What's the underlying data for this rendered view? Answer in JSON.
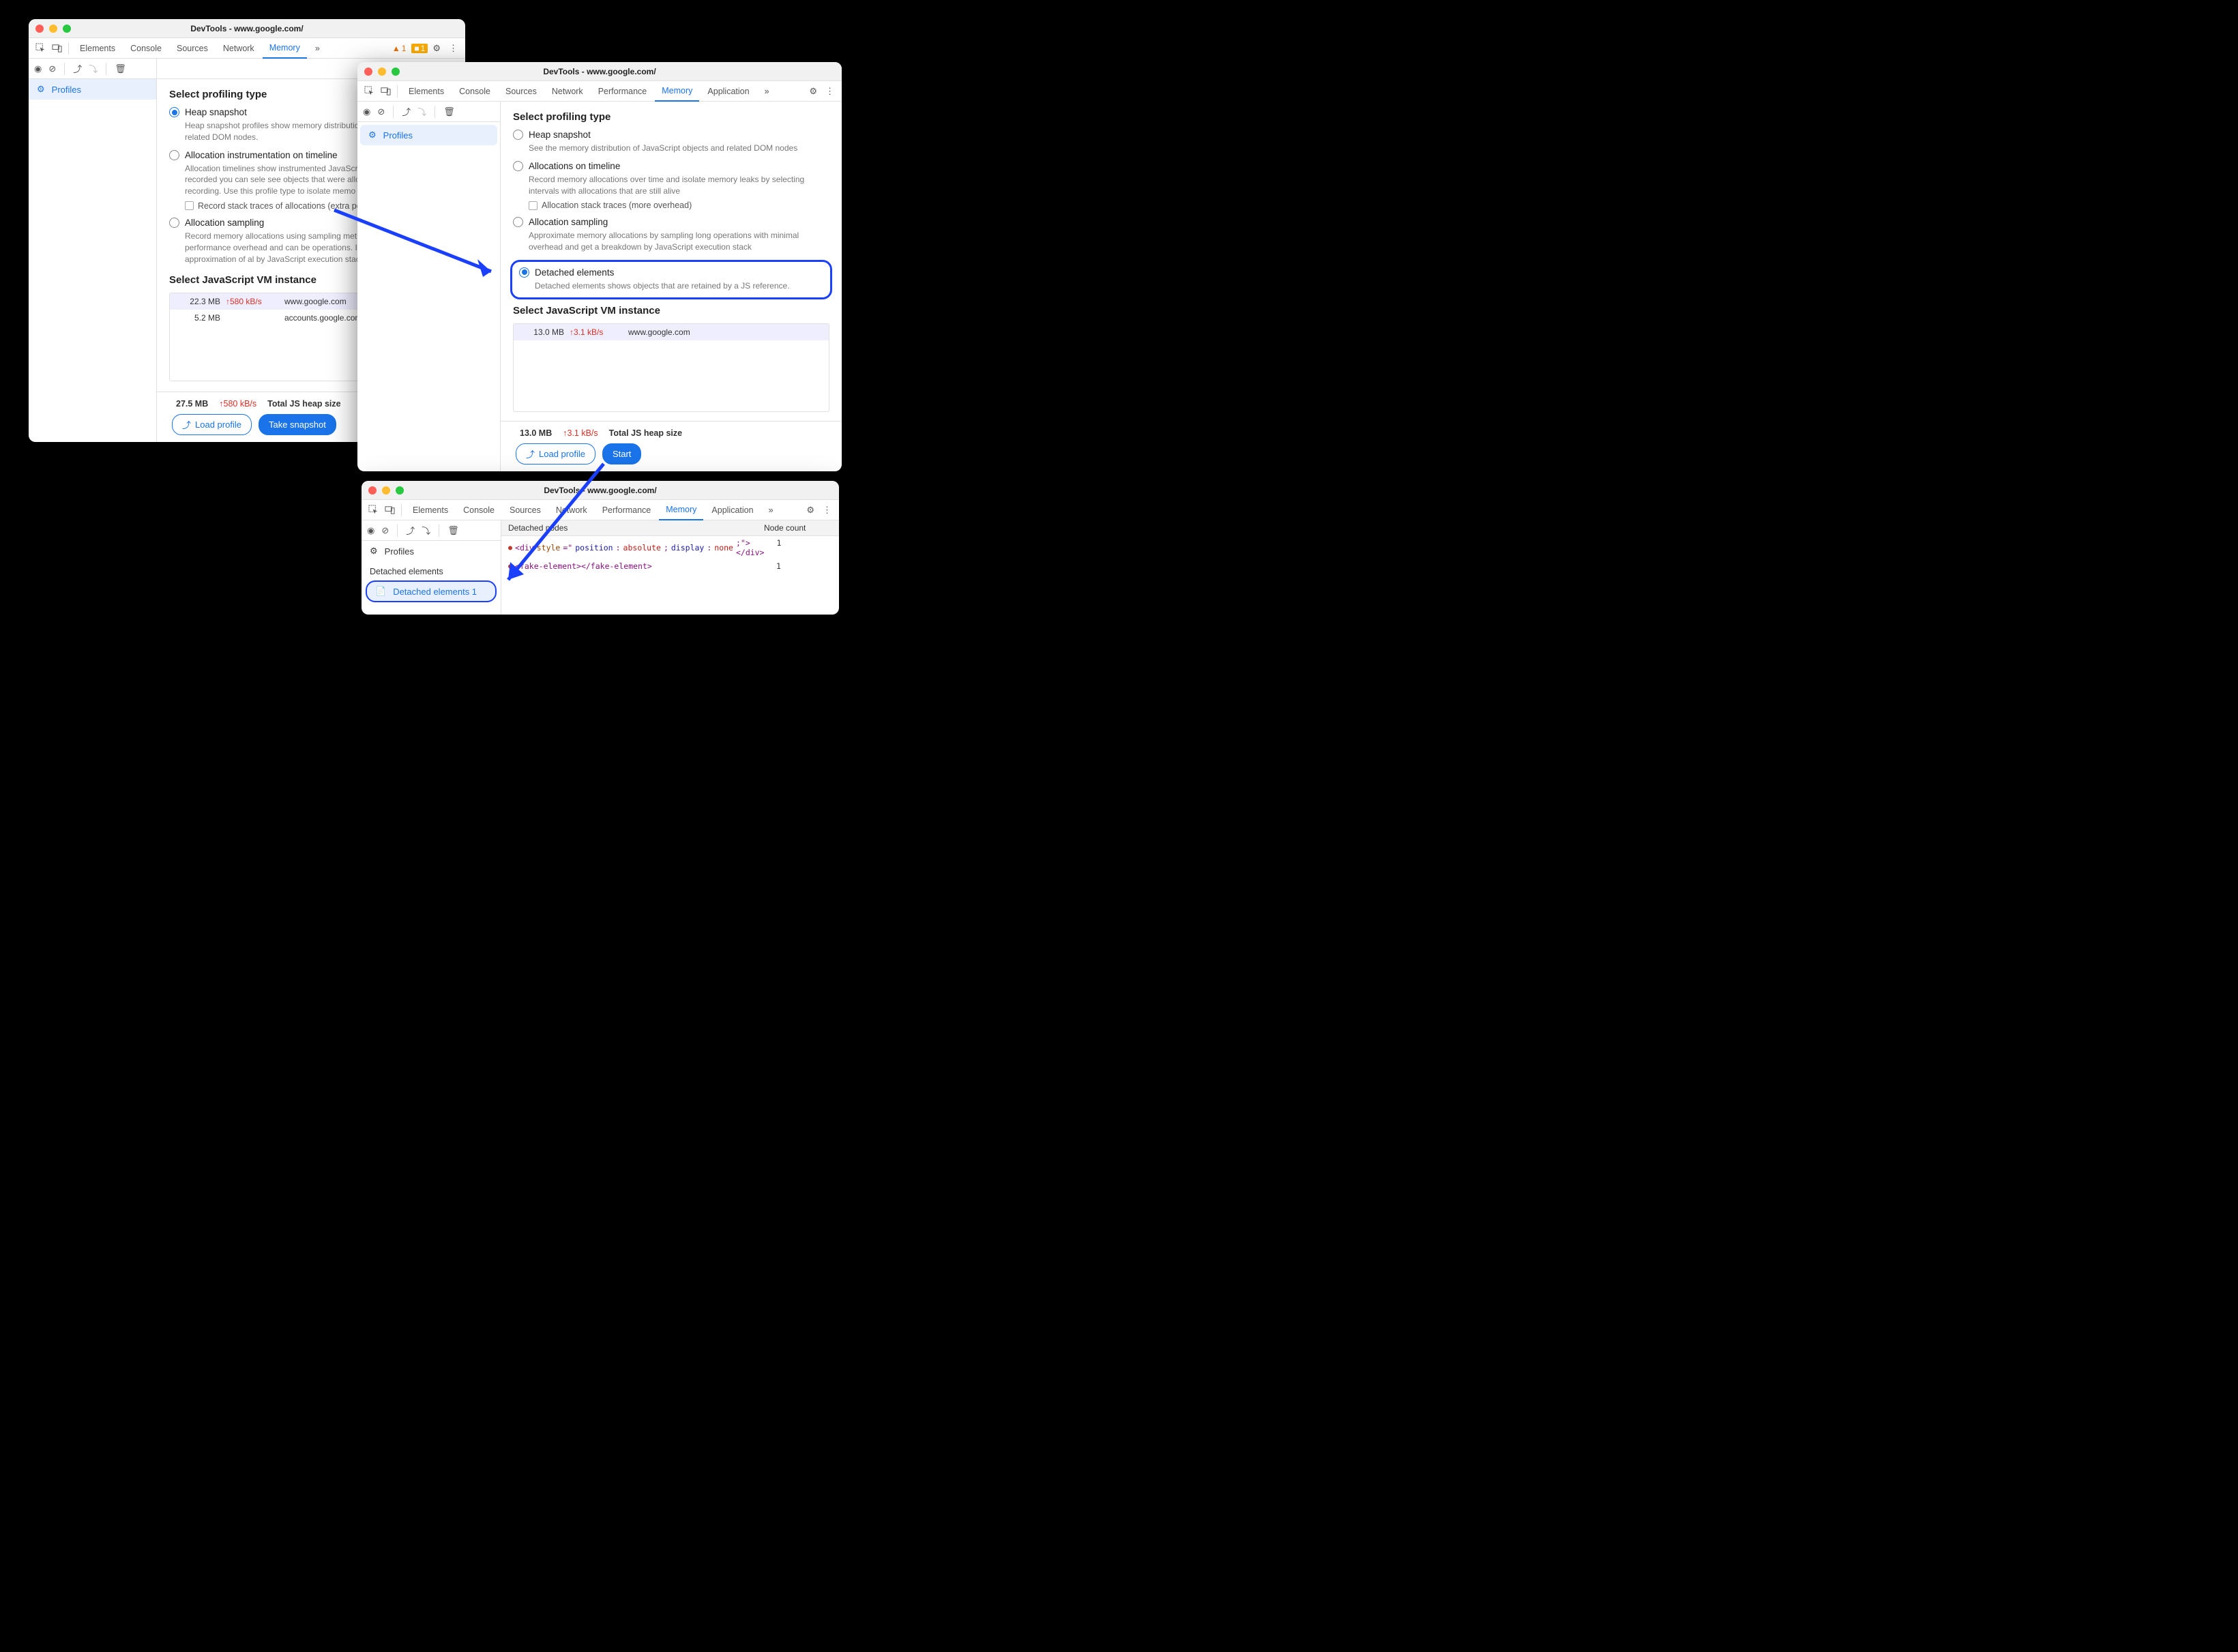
{
  "win1": {
    "title": "DevTools - www.google.com/",
    "tabs": [
      "Elements",
      "Console",
      "Sources",
      "Network",
      "Memory"
    ],
    "active_tab": "Memory",
    "more_tabs": "»",
    "warn_count": "1",
    "err_count": "1",
    "sidebar": {
      "profiles": "Profiles"
    },
    "heading": "Select profiling type",
    "opts": {
      "heap": {
        "label": "Heap snapshot",
        "desc": "Heap snapshot profiles show memory distribution JavaScript objects and related DOM nodes."
      },
      "alloc_tl": {
        "label": "Allocation instrumentation on timeline",
        "desc": "Allocation timelines show instrumented JavaScr over time. Once profile is recorded you can sele see objects that were allocated within it and stil recording. Use this profile type to isolate memo",
        "sub": "Record stack traces of allocations (extra pe"
      },
      "alloc_samp": {
        "label": "Allocation sampling",
        "desc": "Record memory allocations using sampling meth has minimal performance overhead and can be operations. It provides good approximation of al by JavaScript execution stack."
      }
    },
    "vm_heading": "Select JavaScript VM instance",
    "vm": [
      {
        "size": "22.3 MB",
        "rate": "580 kB/s",
        "url": "www.google.com"
      },
      {
        "size": "5.2 MB",
        "rate": "",
        "url": "accounts.google.com: Ro"
      }
    ],
    "footer": {
      "size": "27.5 MB",
      "rate": "580 kB/s",
      "label": "Total JS heap size",
      "load": "Load profile",
      "action": "Take snapshot"
    }
  },
  "win2": {
    "title": "DevTools - www.google.com/",
    "tabs": [
      "Elements",
      "Console",
      "Sources",
      "Network",
      "Performance",
      "Memory",
      "Application"
    ],
    "active_tab": "Memory",
    "more_tabs": "»",
    "sidebar": {
      "profiles": "Profiles"
    },
    "heading": "Select profiling type",
    "opts": {
      "heap": {
        "label": "Heap snapshot",
        "desc": "See the memory distribution of JavaScript objects and related DOM nodes"
      },
      "alloc_tl": {
        "label": "Allocations on timeline",
        "desc": "Record memory allocations over time and isolate memory leaks by selecting intervals with allocations that are still alive",
        "sub": "Allocation stack traces (more overhead)"
      },
      "alloc_samp": {
        "label": "Allocation sampling",
        "desc": "Approximate memory allocations by sampling long operations with minimal overhead and get a breakdown by JavaScript execution stack"
      },
      "detached": {
        "label": "Detached elements",
        "desc": "Detached elements shows objects that are retained by a JS reference."
      }
    },
    "vm_heading": "Select JavaScript VM instance",
    "vm": [
      {
        "size": "13.0 MB",
        "rate": "3.1 kB/s",
        "url": "www.google.com"
      }
    ],
    "footer": {
      "size": "13.0 MB",
      "rate": "3.1 kB/s",
      "label": "Total JS heap size",
      "load": "Load profile",
      "action": "Start"
    }
  },
  "win3": {
    "title": "DevTools - www.google.com/",
    "tabs": [
      "Elements",
      "Console",
      "Sources",
      "Network",
      "Performance",
      "Memory",
      "Application"
    ],
    "active_tab": "Memory",
    "more_tabs": "»",
    "sidebar": {
      "profiles": "Profiles",
      "section": "Detached elements",
      "snapshot": "Detached elements 1"
    },
    "table": {
      "col1": "Detached nodes",
      "col2": "Node count",
      "rows": [
        {
          "html": "<div style=\"position: absolute; display: none;\"></div>",
          "count": "1"
        },
        {
          "html": "<fake-element></fake-element>",
          "count": "1"
        }
      ]
    }
  }
}
